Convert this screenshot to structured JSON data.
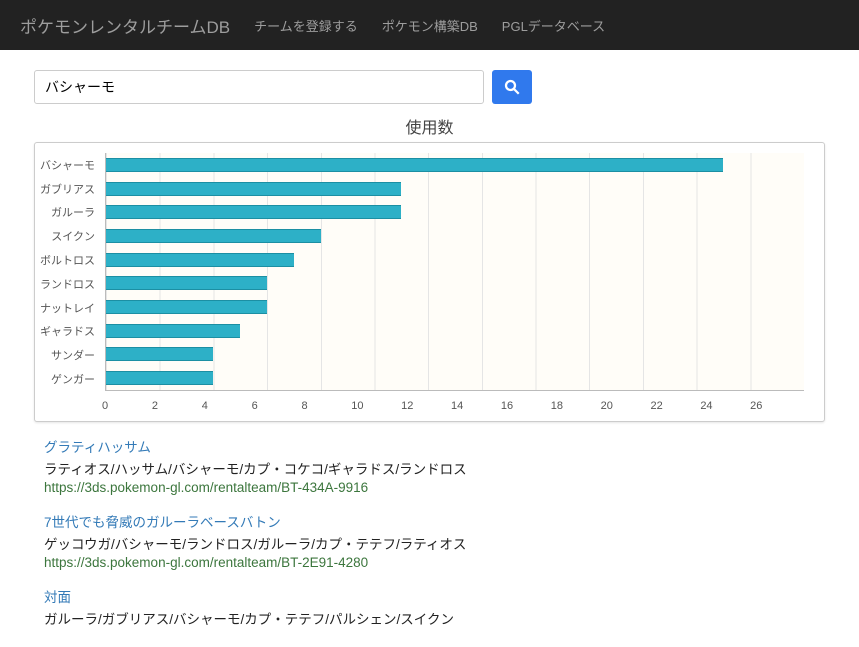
{
  "nav": {
    "brand": "ポケモンレンタルチームDB",
    "links": [
      "チームを登録する",
      "ポケモン構築DB",
      "PGLデータベース"
    ]
  },
  "search": {
    "value": "バシャーモ"
  },
  "chart_data": {
    "type": "bar",
    "title": "使用数",
    "orientation": "horizontal",
    "categories": [
      "バシャーモ",
      "ガブリアス",
      "ガルーラ",
      "スイクン",
      "ボルトロス",
      "ランドロス",
      "ナットレイ",
      "ギャラドス",
      "サンダー",
      "ゲンガー"
    ],
    "values": [
      23,
      11,
      11,
      8,
      7,
      6,
      6,
      5,
      4,
      4
    ],
    "xlim": [
      0,
      26
    ],
    "xticks": [
      0,
      2,
      4,
      6,
      8,
      10,
      12,
      14,
      16,
      18,
      20,
      22,
      24,
      26
    ],
    "xlabel": "",
    "ylabel": ""
  },
  "results": [
    {
      "name": "グラティハッサム",
      "members": "ラティオス/ハッサム/バシャーモ/カプ・コケコ/ギャラドス/ランドロス",
      "url": "https://3ds.pokemon-gl.com/rentalteam/BT-434A-9916"
    },
    {
      "name": "7世代でも脅威のガルーラベースバトン",
      "members": "ゲッコウガ/バシャーモ/ランドロス/ガルーラ/カプ・テテフ/ラティオス",
      "url": "https://3ds.pokemon-gl.com/rentalteam/BT-2E91-4280"
    },
    {
      "name": "対面",
      "members": "ガルーラ/ガブリアス/バシャーモ/カプ・テテフ/パルシェン/スイクン",
      "url": ""
    }
  ]
}
